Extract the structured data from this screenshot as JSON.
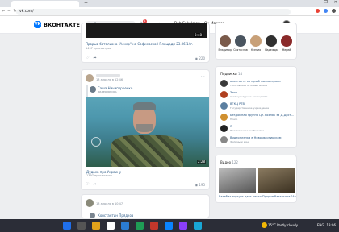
{
  "browser": {
    "url": "vk.com/",
    "new_tab": "+",
    "window_controls": [
      "—",
      "❐",
      "✕"
    ]
  },
  "header": {
    "logo_letters": "VK",
    "logo_text": "ВКОНТАКТЕ",
    "search_placeholder": "Поиск",
    "notification_count": "1",
    "track": "Bob Sakelston – Oy Manner"
  },
  "feed": {
    "post1": {
      "duration": "3:48",
      "title": "Прорыв батальона \"Аскер\" на Софиевской Площади 23.06.14г.",
      "views_line": "1497 просмотров",
      "views": "220"
    },
    "post2": {
      "date": "13 апреля в 12:46",
      "repost_author": "Саша Ничипорренко",
      "repost_sub": "видеозапись",
      "duration": "2:28",
      "caption": "Дудаев про Украину",
      "caption_sub": "1397 просмотров",
      "views": "195"
    },
    "post3": {
      "date": "13 апреля в 10:47",
      "author": "Константин Прядков"
    }
  },
  "friends": [
    {
      "name": "Владимир",
      "color": "#7a5a4a"
    },
    {
      "name": "Святослав",
      "color": "#4a5560"
    },
    {
      "name": "Ксения",
      "color": "#c8a078"
    },
    {
      "name": "Надежда",
      "color": "#303030"
    },
    {
      "name": "Мерей",
      "color": "#8a2a2a"
    }
  ],
  "subscriptions": {
    "title": "Подписки",
    "count": "14",
    "items": [
      {
        "name": "вконтакте который мы потеряли",
        "desc": "голосование за новых мемов",
        "color": "#3a3a3a"
      },
      {
        "name": "Злое",
        "desc": "пост-культурное сообщество",
        "color": "#b04020"
      },
      {
        "name": "ВГКЦ РТВ",
        "desc": "Государственное учреждение",
        "color": "#5b7fa0"
      },
      {
        "name": "Бездомная группа ЦК Хохляк за Д-Дост...",
        "desc": "Юмор",
        "color": "#d09030"
      },
      {
        "name": "Я",
        "desc": "Политическое сообщество",
        "color": "#222222"
      },
      {
        "name": "Видеопленка в Новоквартирском",
        "desc": "Фильмы и кино",
        "color": "#888888"
      }
    ]
  },
  "video": {
    "title": "Видео",
    "count": "122",
    "items": [
      {
        "title": "Вахабит торгует дает место..."
      },
      {
        "title": "Прорыв батальона \"Аскер\"..."
      }
    ]
  },
  "taskbar": {
    "weather": "15°C  Partly cloudy",
    "time": "13:06",
    "lang": "ENG"
  }
}
